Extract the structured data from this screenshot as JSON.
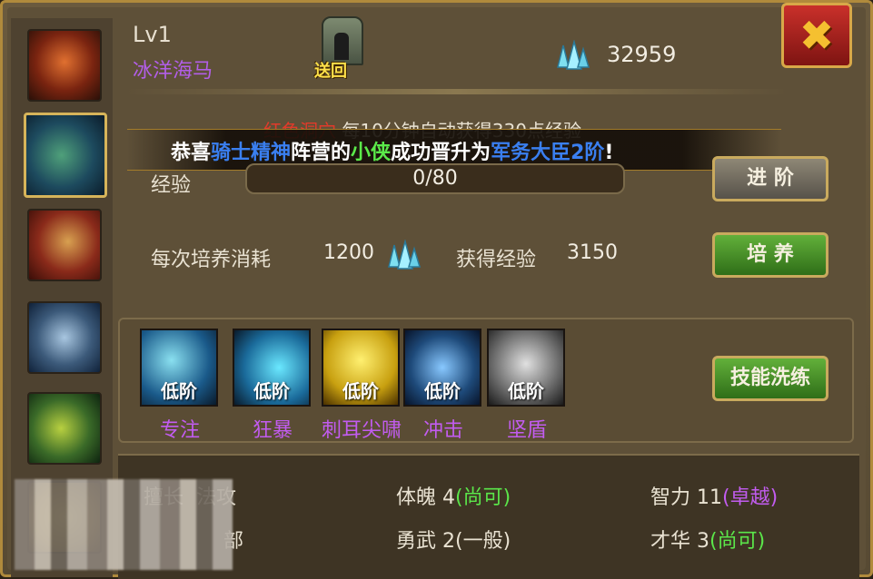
{
  "header": {
    "level": "Lv1",
    "hero_name": "冰洋海马",
    "portal_label": "送回",
    "gems": "32959"
  },
  "cave": {
    "name": "红色洞穴",
    "desc": "每10分钟自动获得330点经验"
  },
  "announcement": {
    "p1": "恭喜",
    "camp": "骑士精神",
    "p2": "阵营的",
    "player": "小侠",
    "p3": "成功晋升为",
    "rank": "军务大臣2阶",
    "p4": "!"
  },
  "exp": {
    "label": "经验",
    "value": "0/80",
    "progress": 0
  },
  "train": {
    "cost_label": "每次培养消耗",
    "cost": "1200",
    "gain_label": "获得经验",
    "gain": "3150"
  },
  "buttons": {
    "advance": "进 阶",
    "train": "培 养",
    "reset_skill": "技能洗练"
  },
  "skills": [
    {
      "tier": "低阶",
      "name": "专注"
    },
    {
      "tier": "低阶",
      "name": "狂暴"
    },
    {
      "tier": "低阶",
      "name": "刺耳尖啸"
    },
    {
      "tier": "低阶",
      "name": "冲击"
    },
    {
      "tier": "低阶",
      "name": "坚盾"
    }
  ],
  "stats": {
    "specialty_label": "擅长",
    "specialty": "法攻",
    "row2_partial": "部",
    "physique_label": "体魄",
    "physique": "4",
    "physique_grade": "(尚可)",
    "valor_label": "勇武",
    "valor": "2",
    "valor_grade": "(一般)",
    "intellect_label": "智力",
    "intellect": "11",
    "intellect_grade": "(卓越)",
    "talent_label": "才华",
    "talent": "3",
    "talent_grade": "(尚可)"
  },
  "colors": {
    "accent_gold": "#c9aa5e",
    "grade_good": "#5be64a",
    "grade_excellent": "#c25cf0",
    "close_red": "#c9302a"
  }
}
